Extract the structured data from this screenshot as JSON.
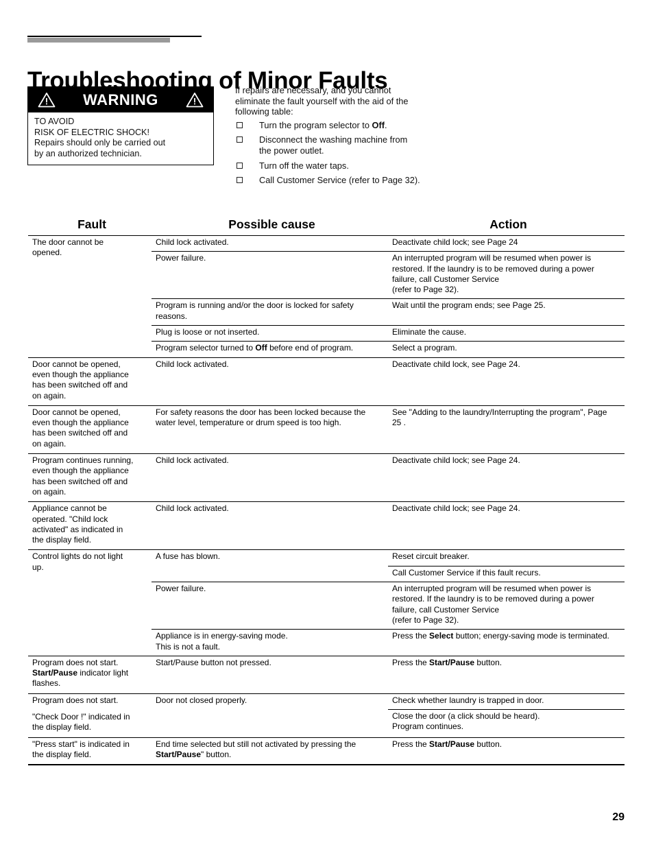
{
  "page_title": "Troubleshooting of Minor Faults",
  "page_number": "29",
  "warning": {
    "heading": "WARNING",
    "line1": "TO AVOID",
    "line2": "RISK OF ELECTRIC SHOCK!",
    "line3": "Repairs should only be carried out",
    "line4": "by an authorized technician."
  },
  "intro": {
    "paragraph": "If repairs are necessary, and you cannot eliminate the fault yourself with the aid of the following table:",
    "bullets": [
      {
        "text_before": "Turn the program selector to ",
        "bold": "Off",
        "text_after": "."
      },
      {
        "text_before": "Disconnect the washing machine from the power outlet.",
        "bold": "",
        "text_after": ""
      },
      {
        "text_before": "Turn off the water taps.",
        "bold": "",
        "text_after": ""
      },
      {
        "text_before": "Call Customer Service (refer to Page 32).",
        "bold": "",
        "text_after": ""
      }
    ]
  },
  "table": {
    "headers": {
      "fault": "Fault",
      "cause": "Possible cause",
      "action": "Action"
    },
    "groups": [
      {
        "fault_lines": [
          "The door cannot be",
          "opened."
        ],
        "rows": [
          {
            "cause": "Child lock activated.",
            "action": "Deactivate child lock; see Page 24"
          },
          {
            "cause": "Power failure.",
            "action": "An interrupted program will be resumed when power is restored. If the laundry is to be removed during a power failure, call Customer Service",
            "action_line2": "(refer to Page 32)."
          },
          {
            "cause": "Program is running and/or the door is locked for safety reasons.",
            "action": "Wait until the program ends; see Page 25."
          },
          {
            "cause": "Plug is loose or not inserted.",
            "action": "Eliminate the cause."
          },
          {
            "cause_before": "Program selector turned to ",
            "cause_bold": "Off",
            "cause_after": " before end of program.",
            "action": "Select a program."
          }
        ]
      },
      {
        "fault_lines": [
          "Door cannot be opened,",
          "even though the appliance",
          "has been switched off and",
          "on again."
        ],
        "rows": [
          {
            "cause": "Child lock activated.",
            "action": "Deactivate child lock, see Page 24."
          }
        ]
      },
      {
        "fault_lines": [
          "Door cannot be opened,",
          "even though the appliance",
          "has been switched off and",
          "on again."
        ],
        "rows": [
          {
            "cause": "For safety reasons the door has been locked because the water level, temperature or drum speed is too high.",
            "action": "See \"Adding to the laundry/Interrupting the program\", Page 25 ."
          }
        ]
      },
      {
        "fault_lines": [
          "Program continues running,",
          "even though the appliance",
          "has been switched off and",
          "on again."
        ],
        "rows": [
          {
            "cause": "Child lock activated.",
            "action": "Deactivate child lock; see Page 24."
          }
        ]
      },
      {
        "fault_lines": [
          "Appliance cannot be",
          "operated. \"Child lock",
          "activated\" as indicated in",
          "the display field."
        ],
        "rows": [
          {
            "cause": "Child lock activated.",
            "action": "Deactivate child lock; see Page 24."
          }
        ]
      },
      {
        "fault_lines": [
          "Control lights do not light",
          "up."
        ],
        "rows": [
          {
            "cause": "A fuse has blown.",
            "action": "Reset circuit breaker."
          },
          {
            "cause": "",
            "action": "Call Customer Service if this fault recurs."
          },
          {
            "cause": "Power failure.",
            "action": "An interrupted program will be resumed when power is restored. If the laundry is to be removed during a power failure, call Customer Service",
            "action_line2": "(refer to Page 32)."
          },
          {
            "cause": "Appliance is in energy-saving mode.",
            "cause_line2": "This is not a fault.",
            "action_before": "Press the ",
            "action_bold": "Select",
            "action_after": " button; energy-saving mode is terminated."
          }
        ]
      },
      {
        "fault_lines": [
          "Program does not start."
        ],
        "fault_bold": "Start/Pause",
        "fault_after": " indicator light flashes.",
        "rows": [
          {
            "cause": "Start/Pause button not pressed.",
            "action_before": "Press the ",
            "action_bold": "Start/Pause",
            "action_after": " button."
          }
        ]
      },
      {
        "fault_lines": [
          "Program does not start."
        ],
        "fault_gap_lines": [
          "\"Check Door !\" indicated in",
          "the display field."
        ],
        "rows": [
          {
            "cause": "Door not closed properly.",
            "action": "Check whether laundry is trapped in door."
          },
          {
            "cause": "",
            "action": "Close the door (a click should be heard).",
            "action_line2": "Program continues."
          }
        ]
      },
      {
        "fault_lines": [
          "\"Press start\" is indicated in",
          "the display field."
        ],
        "rows": [
          {
            "cause_before": "End time selected but still not activated by pressing the ",
            "cause_bold": "Start/Pause",
            "cause_after": "\" button.",
            "action_before": "Press the ",
            "action_bold": "Start/Pause",
            "action_after": " button."
          }
        ]
      }
    ]
  }
}
